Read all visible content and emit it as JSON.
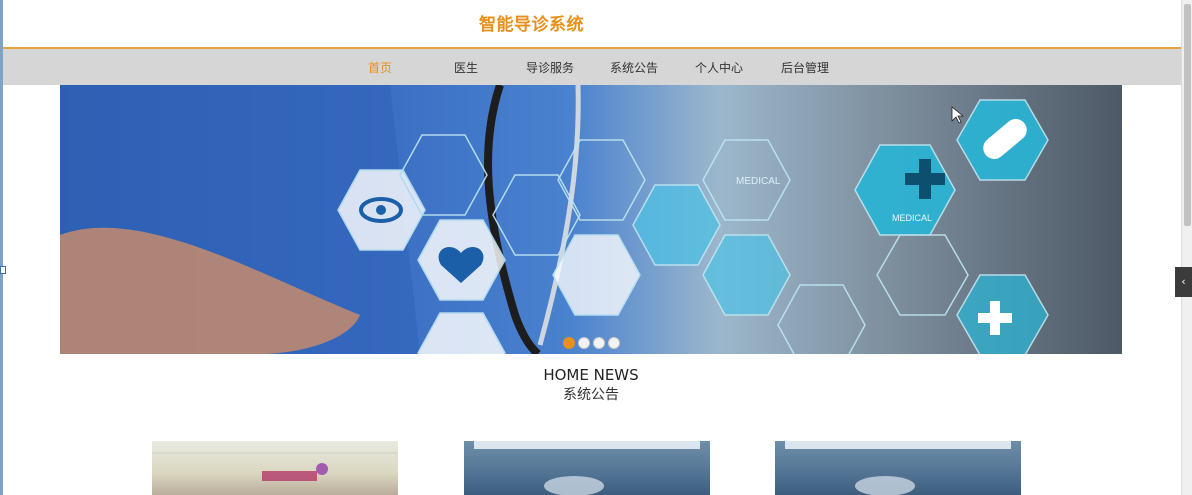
{
  "header": {
    "title": "智能导诊系统"
  },
  "nav": {
    "items": [
      {
        "label": "首页",
        "active": true
      },
      {
        "label": "医生",
        "active": false
      },
      {
        "label": "导诊服务",
        "active": false
      },
      {
        "label": "系统公告",
        "active": false
      },
      {
        "label": "个人中心",
        "active": false
      },
      {
        "label": "后台管理",
        "active": false
      }
    ]
  },
  "banner": {
    "labels": [
      "MEDICAL",
      "MEDICAL"
    ],
    "slide_count": 4,
    "active_slide": 1
  },
  "section": {
    "title_en": "HOME NEWS",
    "title_cn": "系统公告"
  },
  "side_toggle": {
    "icon": "chevron-left-icon",
    "glyph": "‹"
  },
  "colors": {
    "accent": "#e8901c",
    "nav_bg": "#d6d6d6",
    "banner_blue": "#2c5cae",
    "hex_cyan": "#29b5d6"
  }
}
